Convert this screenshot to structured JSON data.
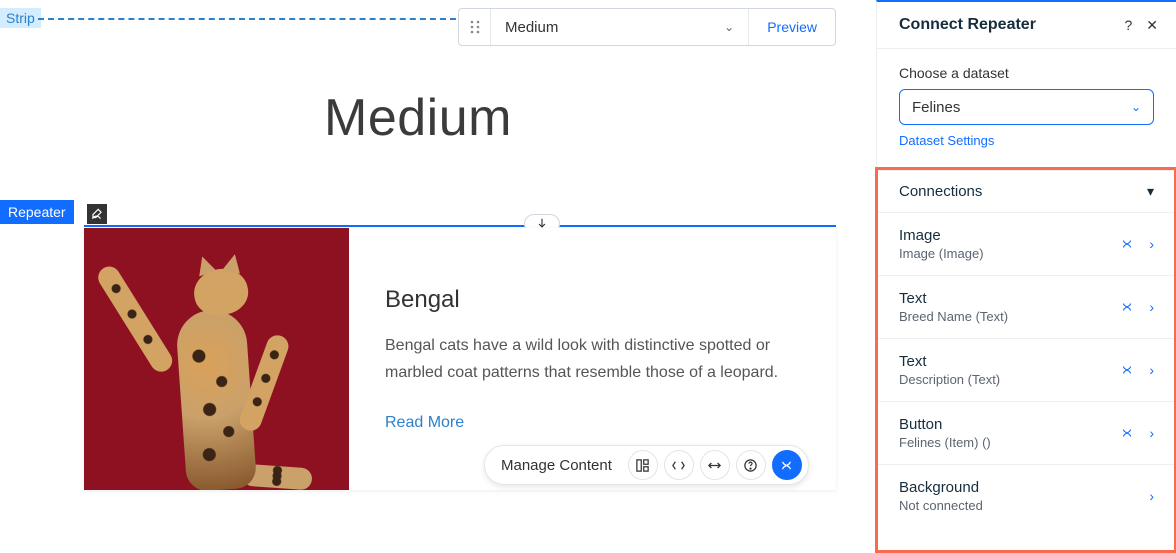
{
  "canvas": {
    "strip_label": "Strip",
    "heading": "Medium",
    "repeater_label": "Repeater",
    "anchor_glyph": "⤓"
  },
  "breakpoint_bar": {
    "name": "Medium",
    "preview": "Preview"
  },
  "card": {
    "title": "Bengal",
    "description": "Bengal cats have a wild look with distinctive spotted or marbled coat patterns that resemble those of a leopard.",
    "link": "Read More"
  },
  "float_toolbar": {
    "label": "Manage Content",
    "icons": {
      "duplicate": "duplicate-icon",
      "code": "code-icon",
      "stretch": "stretch-icon",
      "help": "help-icon",
      "connect": "connect-data-icon"
    }
  },
  "panel": {
    "title": "Connect Repeater",
    "help_glyph": "?",
    "close_glyph": "✕",
    "dataset_label": "Choose a dataset",
    "dataset_value": "Felines",
    "dataset_settings": "Dataset Settings",
    "connections_label": "Connections",
    "rows": [
      {
        "name": "Image",
        "sub": "Image (Image)",
        "linked": true
      },
      {
        "name": "Text",
        "sub": "Breed Name (Text)",
        "linked": true
      },
      {
        "name": "Text",
        "sub": "Description (Text)",
        "linked": true
      },
      {
        "name": "Button",
        "sub": "Felines (Item) ()",
        "linked": true
      },
      {
        "name": "Background",
        "sub": "Not connected",
        "linked": false
      }
    ]
  },
  "colors": {
    "accent": "#116dff",
    "highlight": "#fa6b4e",
    "cat_bg": "#8e1122"
  }
}
